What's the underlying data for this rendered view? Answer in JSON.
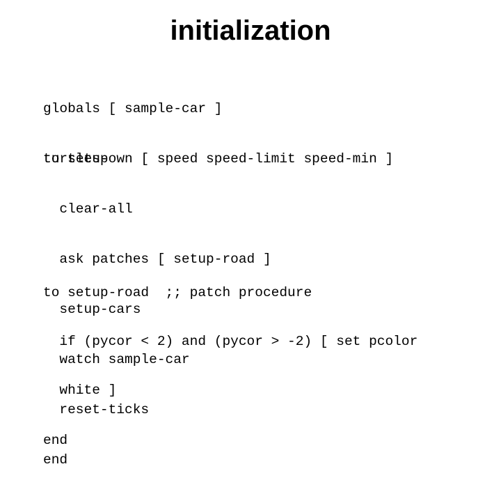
{
  "slide": {
    "title": "initialization",
    "blocks": [
      {
        "lines": [
          "globals [ sample-car ]",
          "turtles-own [ speed speed-limit speed-min ]"
        ]
      },
      {
        "lines": [
          "to setup",
          "  clear-all",
          "  ask patches [ setup-road ]",
          "  setup-cars",
          "  watch sample-car",
          "  reset-ticks",
          "end"
        ]
      },
      {
        "lines": [
          "to setup-road  ;; patch procedure",
          "  if (pycor < 2) and (pycor > -2) [ set pcolor",
          "  white ]",
          "end"
        ]
      }
    ]
  }
}
